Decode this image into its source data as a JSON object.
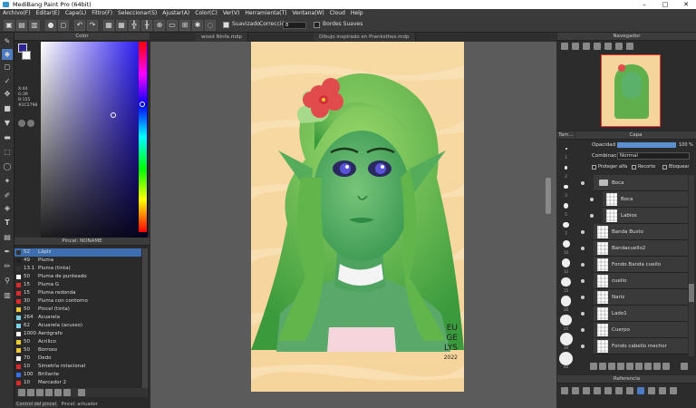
{
  "window": {
    "title": "MediBang Paint Pro (64bit)",
    "controls": [
      "–",
      "□",
      "✕"
    ]
  },
  "menu": [
    "Archivo(F)",
    "Editar(E)",
    "Capa(L)",
    "Filtro(F)",
    "Seleccionar(S)",
    "Ajustar(A)",
    "Color(C)",
    "Ver(V)",
    "Herramienta(T)",
    "Ventana(W)",
    "Cloud",
    "Help"
  ],
  "toolbar": {
    "smoothing_label": "Suavizado",
    "correction_label": "Corrección",
    "correction_value": "8",
    "soft_edges_label": "Bordes Suaves"
  },
  "tabs": [
    "wood Ninfa.mdp",
    "Dibujo inspirado en Pranksthes.mdp"
  ],
  "color_panel": {
    "title": "Color",
    "values": [
      "X:44",
      "G:39",
      "B:155"
    ],
    "hex": "#2C2798",
    "primary": "#2c2798",
    "secondary": "#ffffff"
  },
  "pen_panel": {
    "title": "Pincel: NONAME",
    "pens": [
      {
        "size": "52",
        "name": "Lápiz",
        "color": "#333333",
        "selected": true
      },
      {
        "size": "49",
        "name": "Pluma",
        "color": "#222222"
      },
      {
        "size": "13.1",
        "name": "Pluma (tinta)",
        "color": "#333333"
      },
      {
        "size": "50",
        "name": "Pluma de punteado",
        "color": "#ffffff"
      },
      {
        "size": "15",
        "name": "Pluma G",
        "color": "#e02a2a"
      },
      {
        "size": "15",
        "name": "Pluma redonda",
        "color": "#e02a2a"
      },
      {
        "size": "30",
        "name": "Pluma con contorno",
        "color": "#e02a2a"
      },
      {
        "size": "50",
        "name": "Pincel (tinta)",
        "color": "#f2c832"
      },
      {
        "size": "264",
        "name": "Acuarela",
        "color": "#7ad1e8"
      },
      {
        "size": "62",
        "name": "Acuarela (acusso)",
        "color": "#7ad1e8"
      },
      {
        "size": "1000",
        "name": "Aerógrafo",
        "color": "#ffffff"
      },
      {
        "size": "50",
        "name": "Acrilico",
        "color": "#f2c832"
      },
      {
        "size": "50",
        "name": "Borroso",
        "color": "#f2c832"
      },
      {
        "size": "70",
        "name": "Dedo",
        "color": "#ffffff"
      },
      {
        "size": "10",
        "name": "Simetría rotacional",
        "color": "#e02a2a"
      },
      {
        "size": "100",
        "name": "Brillante",
        "color": "#3a6ef0"
      },
      {
        "size": "10",
        "name": "Marcador 2",
        "color": "#e02a2a"
      }
    ],
    "bottom_tabs": [
      "Control del pincel",
      "Pincel: actuador"
    ]
  },
  "navigator": {
    "title": "Navegador"
  },
  "layer_panel": {
    "title": "Capa",
    "tab_left": "Tam...",
    "opacity_label": "Opacidad",
    "opacity_value": "100 %",
    "opacity_fraction": 1.0,
    "blend_label": "Combinación",
    "blend_value": "Normal",
    "protect_alpha": "Proteger alfa",
    "clipping": "Recorte",
    "lock": "Bloquear",
    "layers": [
      "Boca",
      "Boca",
      "Labios",
      "Banda Busto",
      "Bandacuello2",
      "Fondo Banda cuello",
      "cuello",
      "Nariz",
      "Lado1",
      "Cuerpo",
      "Fondo cabello mechor"
    ]
  },
  "brush_sizes": [
    "1",
    "2",
    "3",
    "5",
    "7",
    "10",
    "12",
    "15",
    "20",
    "25",
    "30",
    "40"
  ],
  "reference": {
    "title": "Referencia"
  },
  "artwork": {
    "signature": [
      "EU",
      "GE",
      "LYS",
      "2022"
    ]
  }
}
